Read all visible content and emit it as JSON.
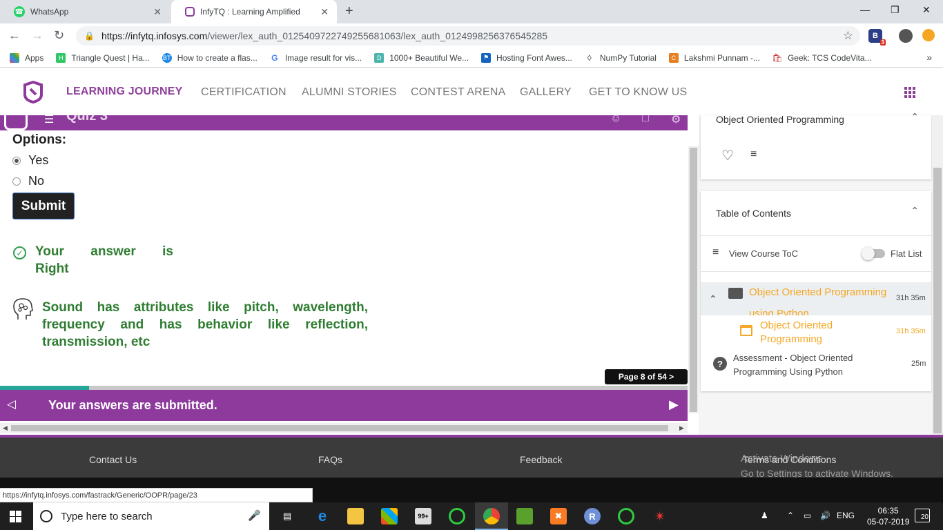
{
  "browser": {
    "tabs": [
      {
        "title": "WhatsApp"
      },
      {
        "title": "InfyTQ : Learning Amplified"
      }
    ],
    "url_host": "https://infytq.infosys.com",
    "url_path": "/viewer/lex_auth_012540972274925568106​3/lex_auth_0124998256376545285",
    "bookmarks": [
      "Apps",
      "Triangle Quest | Ha...",
      "How to create a flas...",
      "Image result for vis...",
      "1000+ Beautiful We...",
      "Hosting Font Awes...",
      "NumPy Tutorial",
      "Lakshmi Punnam -...",
      "Geek: TCS CodeVita..."
    ],
    "extension_badge": "3"
  },
  "site": {
    "nav": [
      "LEARNING JOURNEY",
      "CERTIFICATION",
      "ALUMNI STORIES",
      "CONTEST ARENA",
      "GALLERY",
      "GET TO KNOW US"
    ]
  },
  "quiz": {
    "title": "Quiz 3",
    "options_label": "Options:",
    "options": [
      {
        "label": "Yes",
        "selected": true
      },
      {
        "label": "No",
        "selected": false
      }
    ],
    "submit_label": "Submit",
    "result": "Your answer is Right",
    "feedback": "Sound has attributes like pitch, wavelength, frequency and has behavior like reflection, transmission, etc",
    "page_indicator": "Page 8 of 54 >",
    "progress_fraction": 0.13,
    "submitted_message": "Your answers are submitted."
  },
  "sidebar": {
    "course_title": "Object Oriented Programming",
    "toc_title": "Table of Contents",
    "view_toc": "View Course ToC",
    "flat_list": "Flat List",
    "items": [
      {
        "label": "Object Oriented Programming using Python",
        "duration": "31h 35m"
      },
      {
        "label": "Object Oriented Programming",
        "duration": "31h 35m"
      },
      {
        "label": "Assessment - Object Oriented Programming Using Python",
        "duration": "25m"
      }
    ]
  },
  "footer": {
    "links": [
      "Contact Us",
      "FAQs",
      "Feedback",
      "Terms and Conditions"
    ],
    "watermark_title": "Activate Windows",
    "watermark_sub": "Go to Settings to activate Windows."
  },
  "status_url": "https://infytq.infosys.com/fastrack/Generic/OOPR/page/23",
  "taskbar": {
    "search_placeholder": "Type here to search",
    "lang": "ENG",
    "time": "06:35",
    "date": "05-07-2019",
    "notification_count": "20",
    "mail_badge": "99+"
  },
  "colors": {
    "brand_purple": "#8e3a9d",
    "accent_orange": "#f5a623",
    "success_green": "#2f7d32",
    "progress_teal": "#26a69a"
  }
}
